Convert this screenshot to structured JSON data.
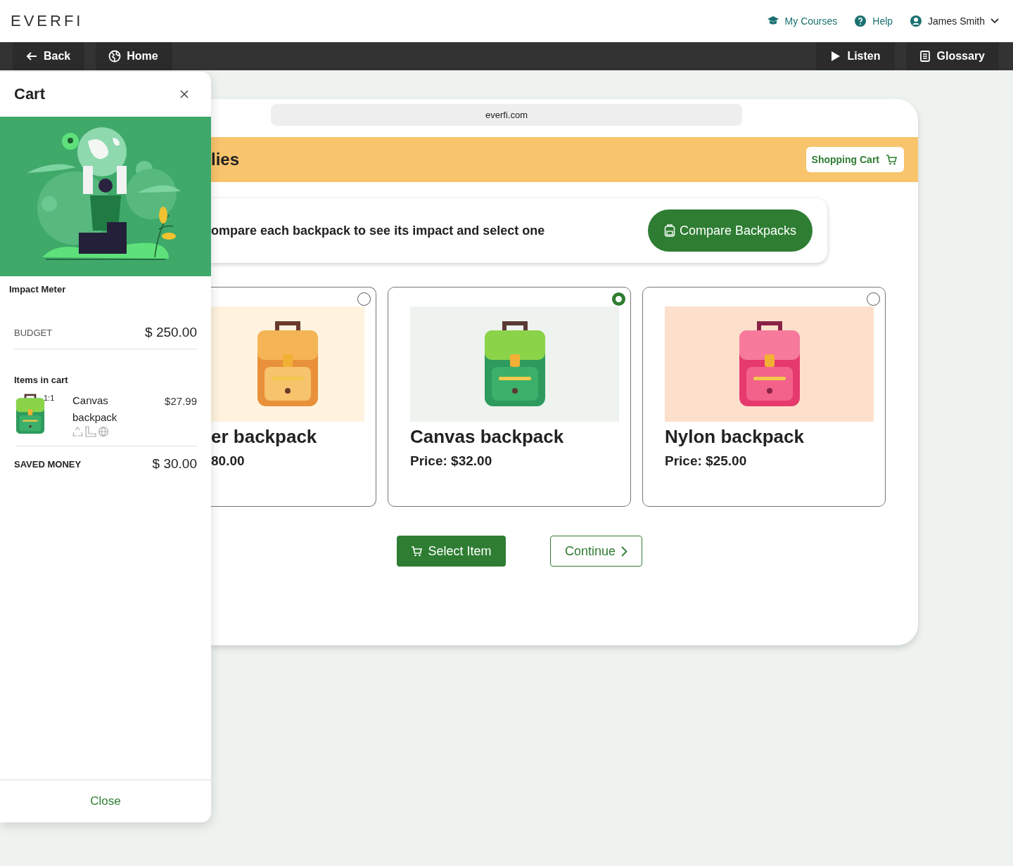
{
  "header": {
    "logo": "EVERFI",
    "links": [
      {
        "kind": "courses",
        "label": "My Courses"
      },
      {
        "kind": "help",
        "label": "Help"
      }
    ],
    "user": "James Smith"
  },
  "nav": {
    "left": [
      {
        "kind": "back",
        "label": "Back"
      },
      {
        "kind": "home",
        "label": "Home"
      }
    ],
    "right": [
      {
        "kind": "listen",
        "label": "Listen"
      },
      {
        "kind": "glossary",
        "label": "Glossary"
      }
    ]
  },
  "cart_panel": {
    "title": "Cart",
    "section_title": "Impact Meter",
    "budget_label": "BUDGET",
    "budget_value": "$ 250.00",
    "items_heading": "Items in cart",
    "items": [
      {
        "kind": "green",
        "name": "Canvas backpack",
        "quantity": "1:1",
        "price": "$27.99"
      }
    ],
    "saved_label": "SAVED MONEY",
    "saved_value": "$ 30.00",
    "close_label": "Close"
  },
  "browser": {
    "url": "everfi.com",
    "banner_title": "lies",
    "cart_button": "Shopping Cart",
    "instruction": "ompare each backpack to see its impact and select one",
    "compare_button": "Compare Backpacks",
    "products": [
      {
        "kind": "orange",
        "name": "er backpack",
        "price": "80.00",
        "selected": false
      },
      {
        "kind": "green",
        "name": "Canvas backpack",
        "price": "Price: $32.00",
        "selected": true
      },
      {
        "kind": "pink",
        "name": "Nylon backpack",
        "price": "Price: $25.00",
        "selected": false
      }
    ],
    "actions": {
      "select": "Select Item",
      "continue": "Continue"
    }
  }
}
